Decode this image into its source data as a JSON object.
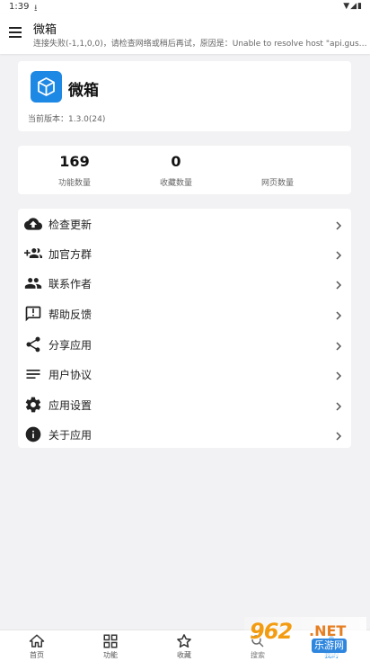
{
  "status_bar": {
    "time": "1:39",
    "download_icon": "download-icon",
    "right_icons": "▼◢▮"
  },
  "appbar": {
    "title": "微箱",
    "subtitle": "连接失败(-1,1,0,0)，请检查网络或稍后再试，原因是：Unable to resolve host \"api.gus…",
    "menu_icon": "hamburger-menu-icon"
  },
  "app_info": {
    "name": "微箱",
    "version": "当前版本：1.3.0(24)",
    "icon": "cube-icon",
    "icon_color": "#1e88e5"
  },
  "stats": [
    {
      "value": "169",
      "label": "功能数量"
    },
    {
      "value": "0",
      "label": "收藏数量"
    },
    {
      "value": "",
      "label": "网页数量"
    }
  ],
  "menu": [
    {
      "label": "检查更新",
      "icon": "cloud-upload-icon"
    },
    {
      "label": "加官方群",
      "icon": "group-add-icon"
    },
    {
      "label": "联系作者",
      "icon": "people-icon"
    },
    {
      "label": "帮助反馈",
      "icon": "feedback-icon"
    },
    {
      "label": "分享应用",
      "icon": "share-icon"
    },
    {
      "label": "用户协议",
      "icon": "notes-icon"
    },
    {
      "label": "应用设置",
      "icon": "settings-icon"
    },
    {
      "label": "关于应用",
      "icon": "info-icon"
    }
  ],
  "bottom_nav": [
    {
      "label": "首页",
      "icon": "home-icon"
    },
    {
      "label": "功能",
      "icon": "apps-icon"
    },
    {
      "label": "收藏",
      "icon": "star-icon"
    },
    {
      "label": "搜索",
      "icon": "search-icon"
    },
    {
      "label": "我的",
      "icon": "person-icon",
      "active": true
    }
  ],
  "watermark": {
    "number": "962",
    "suffix": ".NET",
    "site": "乐游网"
  },
  "colors": {
    "accent": "#1e88e5",
    "background": "#f2f2f4",
    "watermark_orange": "#f39c12"
  }
}
